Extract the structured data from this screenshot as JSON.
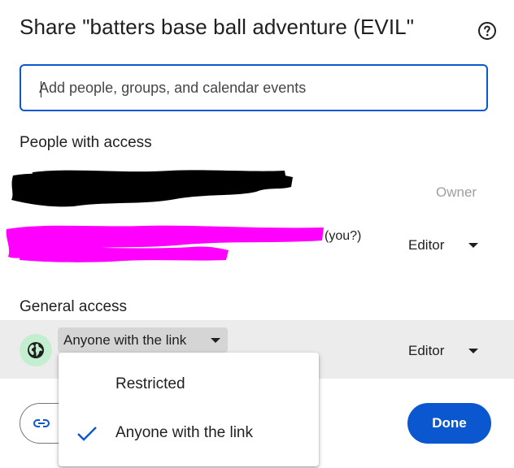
{
  "dialog": {
    "title": "Share \"batters base ball adventure (EVIL\"",
    "help_icon": "help-circle-icon"
  },
  "search": {
    "placeholder": "Add people, groups, and calendar events",
    "value": ""
  },
  "people_section": {
    "heading": "People with access",
    "people": [
      {
        "name_redacted": true,
        "redaction_color": "#000000",
        "role": "Owner"
      },
      {
        "name_redacted": true,
        "redaction_color": "#ff00ff",
        "suffix": "(you?)",
        "role": "Editor"
      }
    ]
  },
  "general_section": {
    "heading": "General access",
    "globe_icon": "globe-icon",
    "link_setting": "Anyone with the link",
    "role": "Editor"
  },
  "link_menu": {
    "options": [
      {
        "label": "Restricted",
        "selected": false
      },
      {
        "label": "Anyone with the link",
        "selected": true
      }
    ]
  },
  "footer": {
    "copy_link_icon": "link-icon",
    "done_label": "Done"
  },
  "colors": {
    "accent": "#0b57d0",
    "globe_bg": "#c4eed0",
    "row_highlight": "#ececec"
  }
}
